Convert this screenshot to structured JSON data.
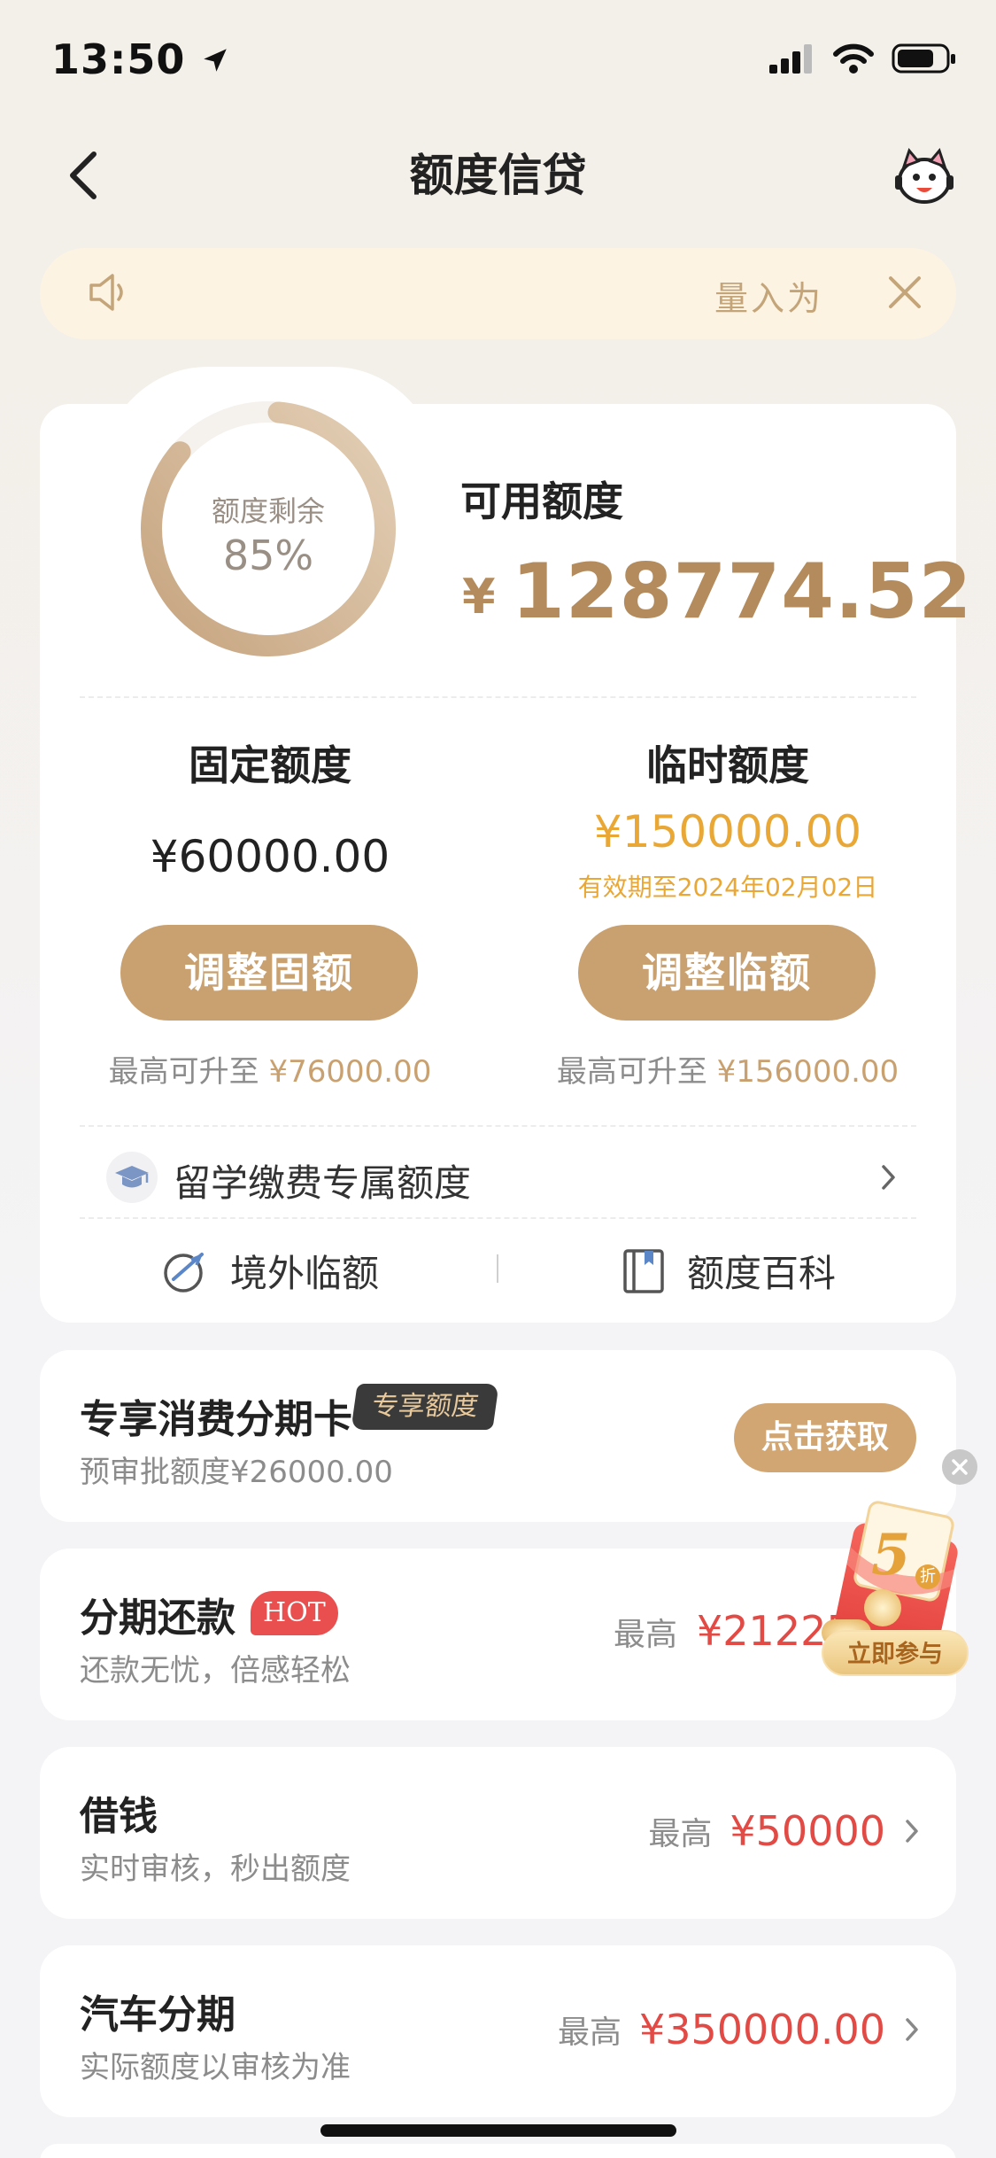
{
  "status_bar": {
    "time": "13:50"
  },
  "nav": {
    "title": "额度信贷"
  },
  "notice": {
    "text": "量入为"
  },
  "quota": {
    "ring_label": "额度剩余",
    "ring_percent": "85%",
    "ring_fraction": 0.85,
    "available_label": "可用额度",
    "currency": "¥",
    "available_amount": "128774.52",
    "fixed": {
      "title": "固定额度",
      "amount": "¥60000.00",
      "button": "调整固额",
      "max_prefix": "最高可升至",
      "max_value": "¥76000.00"
    },
    "temporary": {
      "title": "临时额度",
      "amount": "¥150000.00",
      "expiry": "有效期至2024年02月02日",
      "button": "调整临额",
      "max_prefix": "最高可升至",
      "max_value": "¥156000.00"
    },
    "study_abroad": "留学缴费专属额度",
    "overseas": "境外临额",
    "encyclopedia": "额度百科"
  },
  "cards": {
    "installment_card": {
      "title": "专享消费分期卡",
      "badge": "专享额度",
      "subtitle": "预审批额度¥26000.00",
      "button": "点击获取"
    },
    "installment_repay": {
      "title": "分期还款",
      "badge": "HOT",
      "subtitle": "还款无忧，倍感轻松",
      "max_label": "最高",
      "max_value": "¥21225"
    },
    "borrow": {
      "title": "借钱",
      "subtitle": "实时审核，秒出额度",
      "max_label": "最高",
      "max_value": "¥50000"
    },
    "auto_loan": {
      "title": "汽车分期",
      "subtitle": "实际额度以审核为准",
      "max_label": "最高",
      "max_value": "¥350000.00"
    }
  },
  "promo": {
    "discount": "5",
    "discount_unit": "折",
    "cta": "立即参与"
  },
  "colors": {
    "gold": "#c9a170",
    "accent_red": "#e24b45",
    "amber": "#e9a736"
  }
}
